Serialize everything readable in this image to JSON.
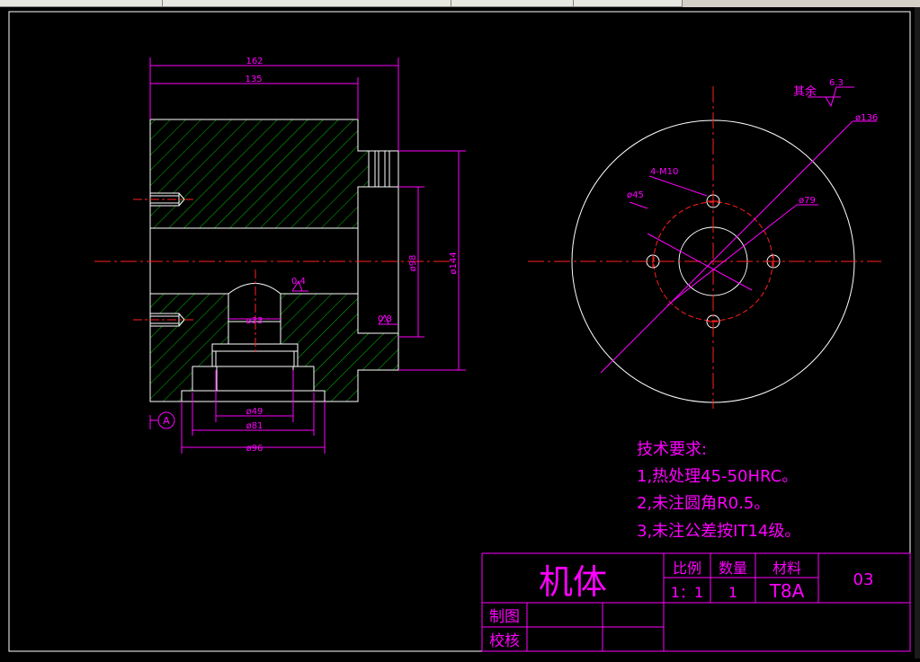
{
  "drawing": {
    "dims": {
      "d162": "162",
      "d135": "135",
      "d98": "ø98",
      "d144": "ø144",
      "d33": "ø33",
      "d49": "ø49",
      "d81": "ø81",
      "d96": "ø96",
      "r04": "0.4",
      "r08": "0.8",
      "datum": "A",
      "d136": "ø136",
      "m10": "4-M10",
      "d45": "ø45",
      "d79": "ø79",
      "rough_label": "其余",
      "rough_val": "6.3"
    },
    "tech": {
      "title": "技术要求:",
      "line1": "1,热处理45-50HRC。",
      "line2": "2,未注圆角R0.5。",
      "line3": "3,未注公差按IT14级。"
    },
    "titleblock": {
      "name": "机体",
      "scale_h": "比例",
      "qty_h": "数量",
      "mat_h": "材料",
      "scale": "1：1",
      "qty": "1",
      "mat": "T8A",
      "num": "03",
      "draw": "制图",
      "check": "校核"
    }
  },
  "colors": {
    "magenta": "#ff00ff",
    "green": "#00c000",
    "red": "#ff2020",
    "white": "#ffffff",
    "background": "#000000"
  }
}
